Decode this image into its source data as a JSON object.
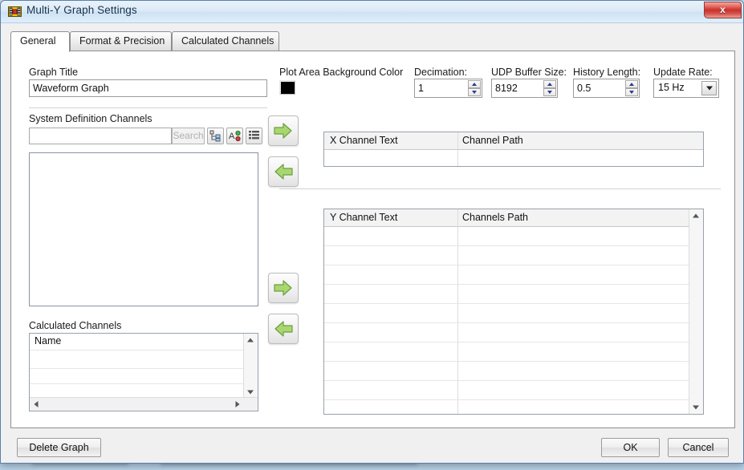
{
  "window": {
    "title": "Multi-Y Graph Settings",
    "app_icon": "labview-vi-icon",
    "close_label": "x"
  },
  "tabs": [
    {
      "label": "General",
      "active": true
    },
    {
      "label": "Format & Precision",
      "active": false
    },
    {
      "label": "Calculated Channels",
      "active": false
    }
  ],
  "general": {
    "graph_title_label": "Graph Title",
    "graph_title_value": "Waveform Graph",
    "plot_bg_label": "Plot Area Background Color",
    "plot_bg_color": "#000000",
    "decimation_label": "Decimation:",
    "decimation_value": "1",
    "udp_buffer_label": "UDP Buffer Size:",
    "udp_buffer_value": "8192",
    "history_label": "History Length:",
    "history_value": "0.5",
    "update_rate_label": "Update Rate:",
    "update_rate_value": "15 Hz",
    "sysdef_label": "System Definition Channels",
    "search_value": "",
    "search_button_label": "Search",
    "view_buttons": [
      "tree-view-icon",
      "sort-alpha-icon",
      "list-view-icon"
    ],
    "sysdef_items": [],
    "calculated_label": "Calculated Channels",
    "calculated_column": "Name",
    "calculated_items": []
  },
  "x_table": {
    "columns": [
      "X Channel Text",
      "Channel Path"
    ],
    "rows": []
  },
  "y_table": {
    "columns": [
      "Y Channel Text",
      "Channels Path"
    ],
    "rows": []
  },
  "transfer": {
    "x_add_icon": "arrow-right-icon",
    "x_remove_icon": "arrow-left-icon",
    "y_add_icon": "arrow-right-icon",
    "y_remove_icon": "arrow-left-icon"
  },
  "footer": {
    "delete_label": "Delete Graph",
    "ok_label": "OK",
    "cancel_label": "Cancel"
  }
}
